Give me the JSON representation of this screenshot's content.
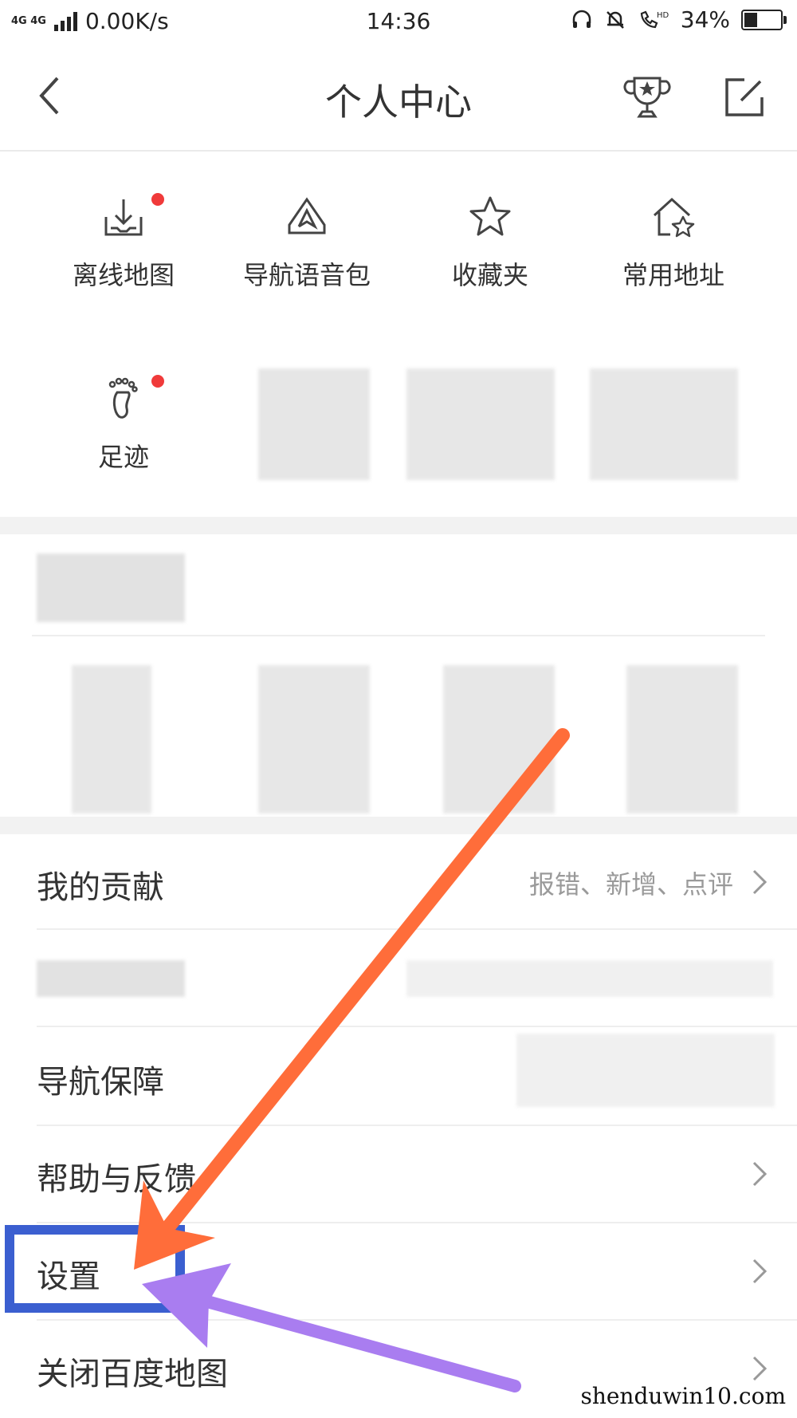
{
  "status_bar": {
    "network": "4G 4G",
    "speed": "0.00K/s",
    "time": "14:36",
    "hd": "HD",
    "battery": "34%",
    "battery_level": 0.34
  },
  "header": {
    "title": "个人中心",
    "icons": [
      "back-icon",
      "trophy-icon",
      "edit-icon"
    ]
  },
  "tools": [
    {
      "label": "离线地图",
      "icon": "offline-map-icon",
      "has_dot": true
    },
    {
      "label": "导航语音包",
      "icon": "nav-voice-icon",
      "has_dot": false
    },
    {
      "label": "收藏夹",
      "icon": "star-icon",
      "has_dot": false
    },
    {
      "label": "常用地址",
      "icon": "home-star-icon",
      "has_dot": false
    },
    {
      "label": "足迹",
      "icon": "footprint-icon",
      "has_dot": true
    }
  ],
  "menu": [
    {
      "label": "我的贡献",
      "sub": "报错、新增、点评"
    },
    {
      "label": "导航保障",
      "sub": ""
    },
    {
      "label": "帮助与反馈",
      "sub": ""
    },
    {
      "label": "设置",
      "sub": ""
    },
    {
      "label": "关闭百度地图",
      "sub": ""
    }
  ],
  "watermark": "shenduwin10.com",
  "colors": {
    "accent_red": "#f03a3a",
    "highlight_blue": "#3b5fd0",
    "arrow_orange": "#ff6d3a",
    "arrow_purple": "#a97df0"
  }
}
